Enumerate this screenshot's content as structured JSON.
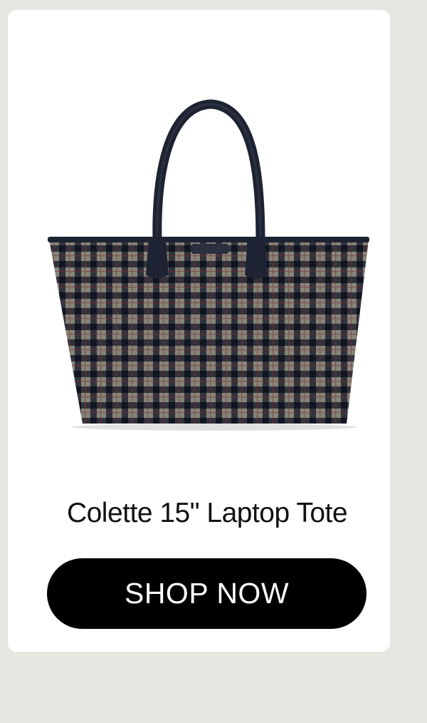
{
  "product": {
    "image_alt": "tote-bag-image",
    "title": "Colette 15\" Laptop Tote"
  },
  "cta": {
    "label": "SHOP NOW"
  },
  "colors": {
    "background": "#e6e7e1",
    "card": "#ffffff",
    "button": "#000000",
    "button_text": "#ffffff",
    "bag_dark": "#1b1f2b",
    "bag_light": "#8b8676",
    "bag_red": "#6a2a30"
  }
}
